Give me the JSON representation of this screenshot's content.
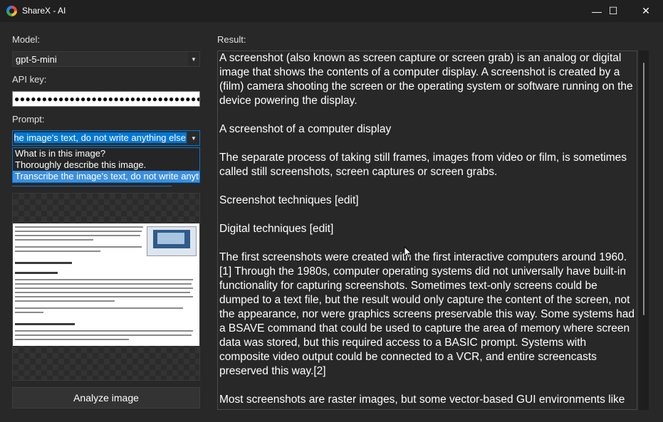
{
  "window": {
    "title": "ShareX - AI",
    "minimize_glyph": "—",
    "maximize_glyph": "☐",
    "close_glyph": "✕"
  },
  "model": {
    "label": "Model:",
    "value": "gpt-5-mini"
  },
  "api_key": {
    "label": "API key:",
    "value": "●●●●●●●●●●●●●●●●●●●●●●●●●●●●●●●●●●●●●●●●●●●●●●●●●●●"
  },
  "prompt": {
    "label": "Prompt:",
    "value": "Transcribe the image's text, do not write anything else.",
    "options": [
      "What is in this image?",
      "Thoroughly describe this image.",
      "Transcribe the image's text, do not write anything else."
    ]
  },
  "analyze_button": "Analyze image",
  "result": {
    "label": "Result:",
    "paragraphs": [
      "A screenshot (also known as screen capture or screen grab) is an analog or digital image that shows the contents of a computer display. A screenshot is created by a (film) camera shooting the screen or the operating system or software running on the device powering the display.",
      "A screenshot of a computer display",
      "The separate process of taking still frames, images from video or film, is sometimes called still screenshots, screen captures or screen grabs.",
      "Screenshot techniques [edit]",
      "Digital techniques [edit]",
      "The first screenshots were created with the first interactive computers around 1960.[1] Through the 1980s, computer operating systems did not universally have built-in functionality for capturing screenshots. Sometimes text-only screens could be dumped to a text file, but the result would only capture the content of the screen, not the appearance, nor were graphics screens preservable this way. Some systems had a BSAVE command that could be used to capture the area of memory where screen data was stored, but this required access to a BASIC prompt. Systems with composite video output could be connected to a VCR, and entire screencasts preserved this way.[2]",
      "Most screenshots are raster images, but some vector-based GUI environments like"
    ]
  },
  "colors": {
    "accent": "#0078d7",
    "background": "#282828",
    "titlebar": "#202020"
  }
}
